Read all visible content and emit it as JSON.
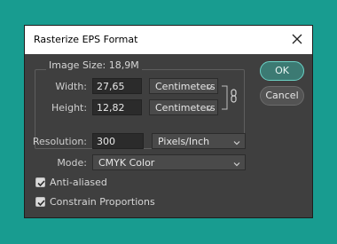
{
  "dialog": {
    "title": "Rasterize EPS Format",
    "close_icon": "close-icon"
  },
  "image_size": {
    "label": "Image Size: 18,9M",
    "width": {
      "label": "Width:",
      "value": "27,65",
      "unit": "Centimeters"
    },
    "height": {
      "label": "Height:",
      "value": "12,82",
      "unit": "Centimeters"
    },
    "link_icon": "chain-link-icon"
  },
  "resolution": {
    "label": "Resolution:",
    "value": "300",
    "unit": "Pixels/Inch"
  },
  "mode": {
    "label": "Mode:",
    "value": "CMYK Color"
  },
  "checkboxes": {
    "anti_aliased": {
      "label": "Anti-aliased",
      "checked": true
    },
    "constrain": {
      "label": "Constrain Proportions",
      "checked": true
    }
  },
  "buttons": {
    "ok": "OK",
    "cancel": "Cancel"
  },
  "colors": {
    "background": "#189c90",
    "dialog": "#3f3f3f",
    "accent": "#6bd2c6"
  }
}
